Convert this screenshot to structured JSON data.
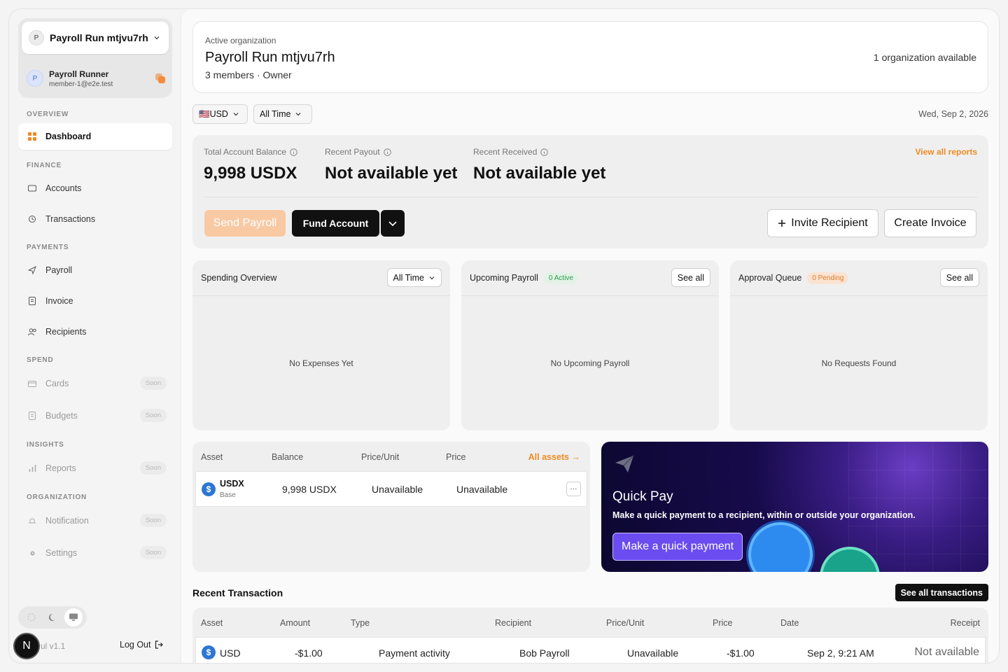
{
  "sidebar": {
    "org_avatar": "P",
    "org_name": "Payroll Run mtjvu7rh",
    "user_avatar": "P",
    "user_name": "Payroll Runner",
    "user_email": "member-1@e2e.test",
    "sections": {
      "overview": "OVERVIEW",
      "finance": "FINANCE",
      "payments": "PAYMENTS",
      "spend": "SPEND",
      "insights": "INSIGHTS",
      "organization": "ORGANIZATION"
    },
    "items": {
      "dashboard": "Dashboard",
      "accounts": "Accounts",
      "transactions": "Transactions",
      "payroll": "Payroll",
      "invoice": "Invoice",
      "recipients": "Recipients",
      "cards": "Cards",
      "budgets": "Budgets",
      "reports": "Reports",
      "notification": "Notification",
      "settings": "Settings"
    },
    "soon_label": "Soon",
    "version": "ul v1.1",
    "logout": "Log Out",
    "n_badge": "N"
  },
  "header": {
    "label": "Active organization",
    "title": "Payroll Run mtjvu7rh",
    "meta": "3 members · Owner",
    "available": "1 organization available"
  },
  "filters": {
    "currency": "🇺🇸USD",
    "period": "All Time",
    "date": "Wed, Sep 2, 2026"
  },
  "balance": {
    "total_label": "Total Account Balance",
    "total_value": "9,998 USDX",
    "payout_label": "Recent Payout",
    "payout_value": "Not available yet",
    "received_label": "Recent Received",
    "received_value": "Not available yet",
    "view_reports": "View all reports",
    "send_payroll": "Send Payroll",
    "fund_account": "Fund Account",
    "invite_recipient": "Invite Recipient",
    "create_invoice": "Create Invoice"
  },
  "panels": {
    "spending": {
      "title": "Spending Overview",
      "filter": "All Time",
      "empty": "No Expenses Yet"
    },
    "upcoming": {
      "title": "Upcoming Payroll",
      "badge": "0 Active",
      "button": "See all",
      "empty": "No Upcoming Payroll"
    },
    "approval": {
      "title": "Approval Queue",
      "badge": "0 Pending",
      "button": "See all",
      "empty": "No Requests Found"
    }
  },
  "assets": {
    "headers": [
      "Asset",
      "Balance",
      "Price/Unit",
      "Price"
    ],
    "all_assets": "All assets",
    "row": {
      "symbol": "USDX",
      "network": "Base",
      "balance": "9,998 USDX",
      "price_unit": "Unavailable",
      "price": "Unavailable",
      "more": "···"
    }
  },
  "quickpay": {
    "title": "Quick Pay",
    "description": "Make a quick payment to a recipient, within or outside your organization.",
    "button": "Make a quick payment"
  },
  "recent": {
    "title": "Recent Transaction",
    "see_all": "See all transactions",
    "headers": [
      "Asset",
      "Amount",
      "Type",
      "Recipient",
      "Price/Unit",
      "Price",
      "Date",
      "Receipt"
    ],
    "row": {
      "asset": "USD",
      "amount": "-$1.00",
      "type": "Payment activity",
      "recipient": "Bob Payroll",
      "price_unit": "Unavailable",
      "price": "-$1.00",
      "date": "Sep 2, 9:21 AM",
      "receipt": "Not available"
    }
  },
  "colors": {
    "accent": "#f08a23",
    "send_disabled": "#f8c9a3",
    "quickpay_button": "#6a4cf0"
  }
}
